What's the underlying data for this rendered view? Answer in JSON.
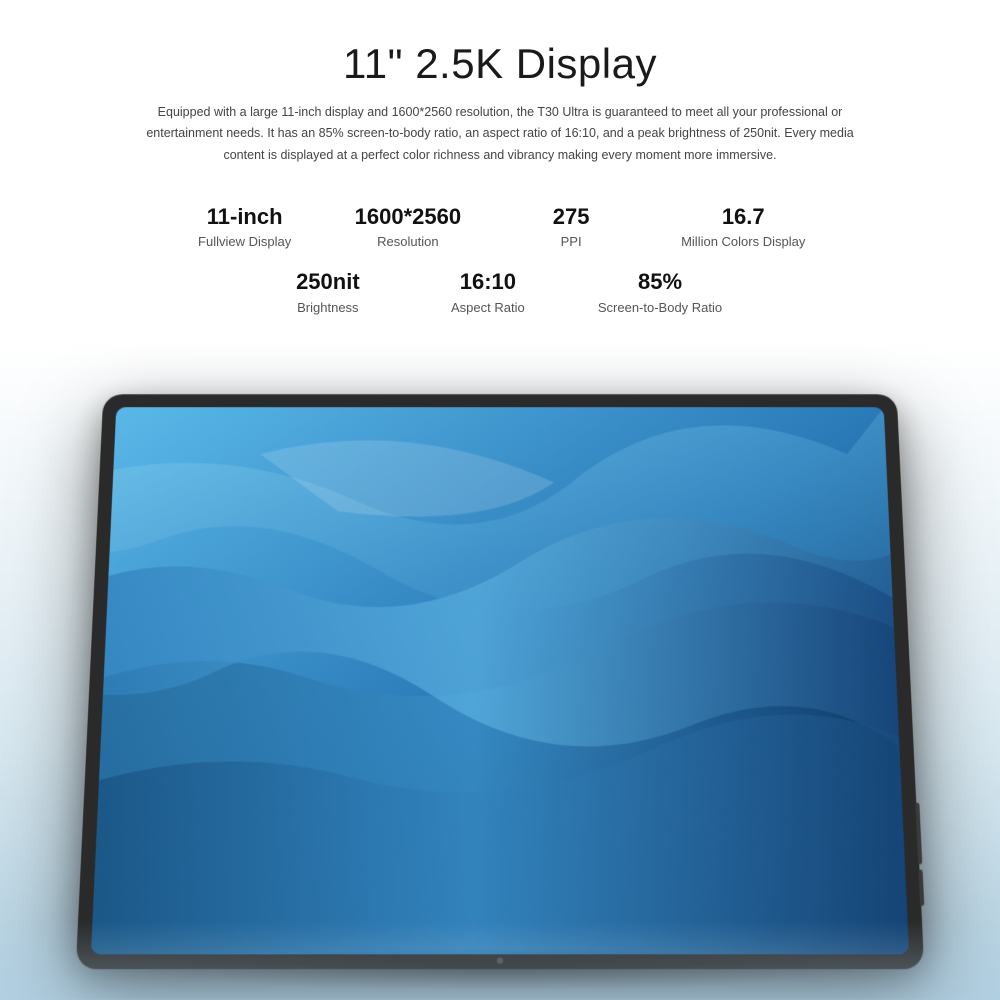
{
  "header": {
    "title": "11\" 2.5K Display",
    "description": "Equipped with a large 11-inch display and 1600*2560 resolution, the T30 Ultra is guaranteed to meet all your professional or entertainment needs. It has an 85% screen-to-body ratio, an aspect ratio of 16:10, and a peak brightness of 250nit. Every media content is displayed at a perfect color richness and vibrancy making every moment more immersive."
  },
  "specs": {
    "row1": [
      {
        "value": "11-inch",
        "label": "Fullview Display"
      },
      {
        "value": "1600*2560",
        "label": "Resolution"
      },
      {
        "value": "275",
        "label": "PPI"
      },
      {
        "value": "16.7",
        "label": "Million Colors Display"
      }
    ],
    "row2": [
      {
        "value": "250nit",
        "label": "Brightness"
      },
      {
        "value": "16:10",
        "label": "Aspect Ratio"
      },
      {
        "value": "85%",
        "label": "Screen-to-Body Ratio"
      }
    ]
  }
}
